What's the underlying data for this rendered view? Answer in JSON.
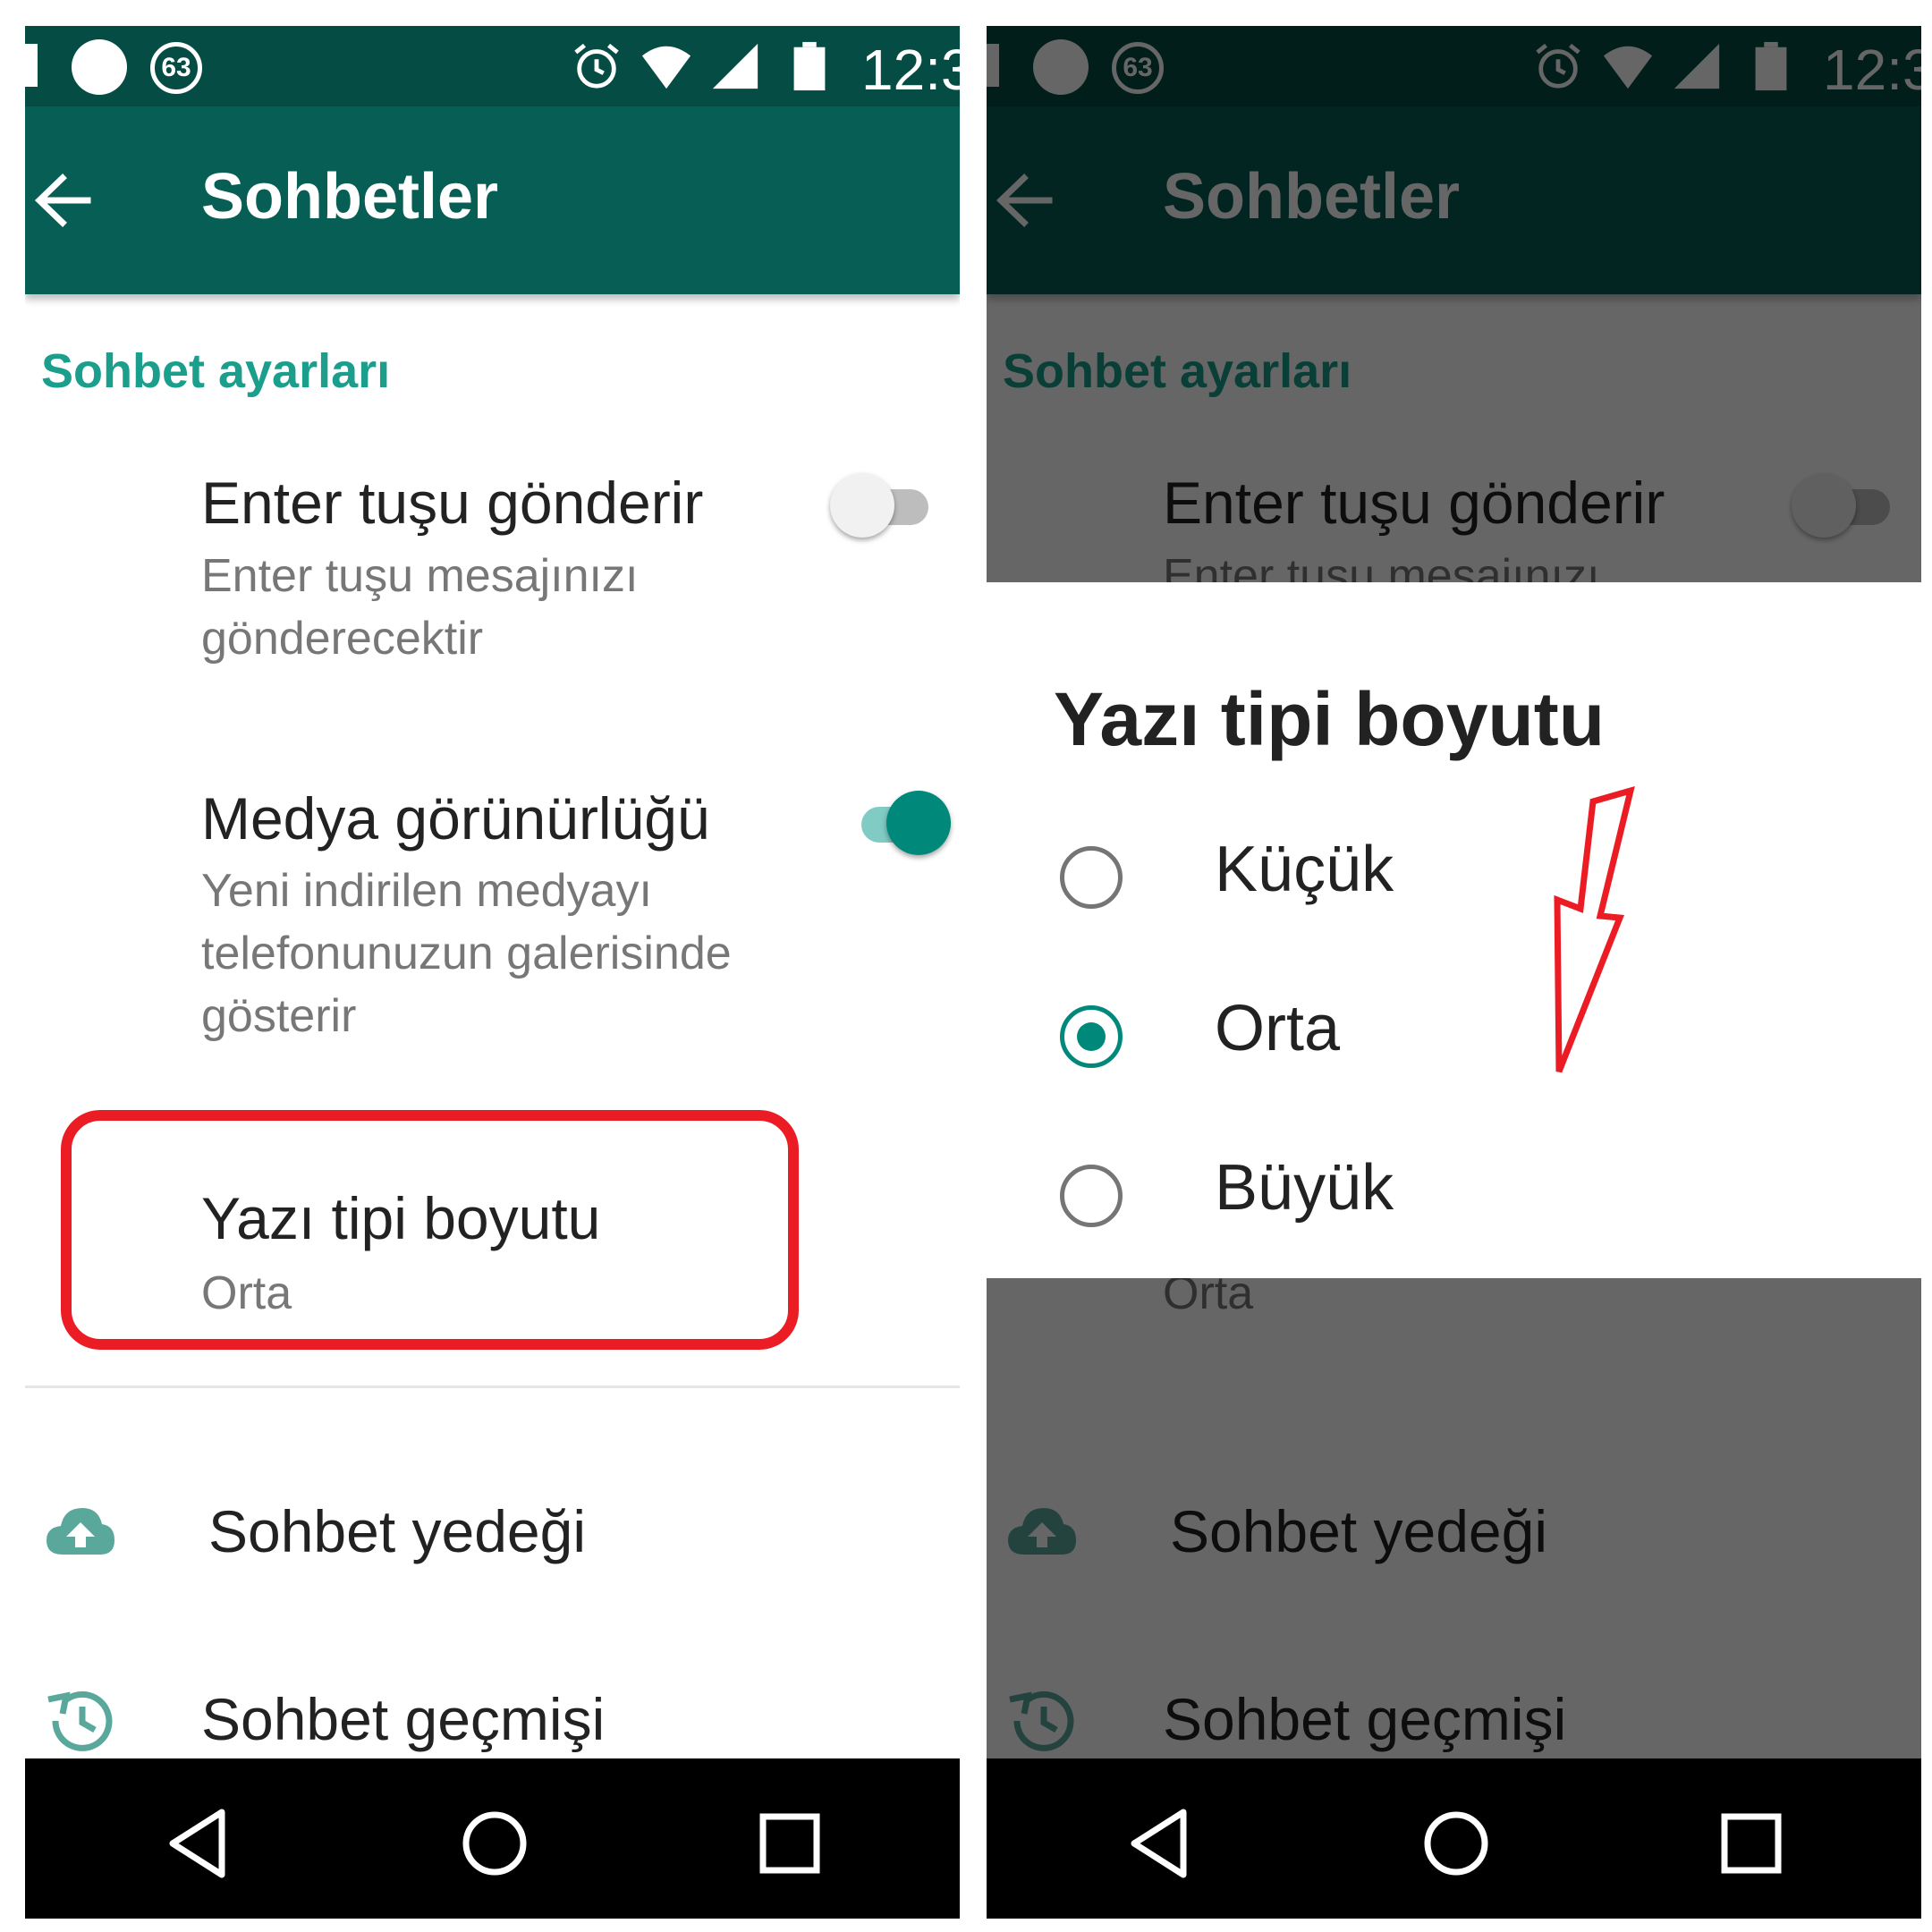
{
  "status_bar": {
    "badge": "63",
    "time": "12:3",
    "icons": [
      "sim-icon",
      "notification-dot-icon",
      "badge-63-icon",
      "alarm-icon",
      "wifi-icon",
      "signal-icon",
      "battery-icon"
    ]
  },
  "app_bar": {
    "title": "Sohbetler",
    "back_icon": "arrow-back-icon"
  },
  "settings": {
    "section_header": "Sohbet ayarları",
    "enter_sends": {
      "title": "Enter tuşu gönderir",
      "subtitle": "Enter tuşu mesajınızı gönderecektir",
      "enabled": false
    },
    "media_visibility": {
      "title": "Medya görünürlüğü",
      "subtitle": "Yeni indirilen medyayı telefonunuzun galerisinde gösterir",
      "enabled": true
    },
    "font_size": {
      "title": "Yazı tipi boyutu",
      "value": "Orta"
    },
    "chat_backup": {
      "title": "Sohbet yedeği",
      "icon": "cloud-upload-icon"
    },
    "chat_history": {
      "title": "Sohbet geçmişi",
      "icon": "history-icon"
    }
  },
  "dialog": {
    "title": "Yazı tipi boyutu",
    "options": [
      {
        "label": "Küçük",
        "selected": false
      },
      {
        "label": "Orta",
        "selected": true
      },
      {
        "label": "Büyük",
        "selected": false
      }
    ]
  },
  "nav_bar": {
    "icons": [
      "back-triangle-icon",
      "home-circle-icon",
      "recents-square-icon"
    ]
  },
  "colors": {
    "app_bar": "#075e54",
    "status_bar": "#054d44",
    "accent": "#00897b",
    "section_header": "#1b9e8c",
    "highlight": "#ec1c24"
  }
}
